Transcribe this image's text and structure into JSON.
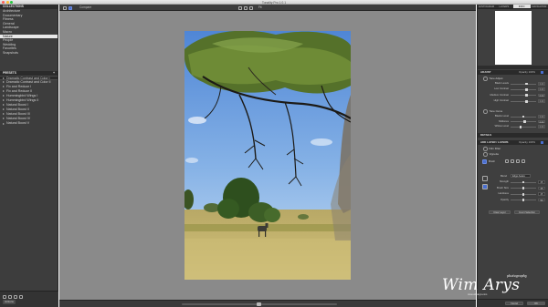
{
  "window": {
    "title": "Tonality Pro 1.0.1"
  },
  "left_panel": {
    "collections_title": "COLLECTIONS",
    "collections": [
      {
        "label": "Architecture",
        "selected": false
      },
      {
        "label": "Documentary",
        "selected": false
      },
      {
        "label": "Fitness",
        "selected": false
      },
      {
        "label": "General",
        "selected": false
      },
      {
        "label": "Landscape",
        "selected": false
      },
      {
        "label": "Macro",
        "selected": false
      },
      {
        "label": "Nature",
        "selected": true
      },
      {
        "label": "People",
        "selected": false
      },
      {
        "label": "Wedding",
        "selected": false
      },
      {
        "label": "Favorites",
        "selected": false
      },
      {
        "label": "Snapshots",
        "selected": false
      }
    ],
    "presets_title": "PRESETS",
    "presets_add": "+",
    "presets": [
      {
        "label": "Dramatic Contrast and Color I",
        "selected": true
      },
      {
        "label": "Dramatic Contrast and Color II",
        "selected": false
      },
      {
        "label": "Fix and Reduce I",
        "selected": false
      },
      {
        "label": "Fix and Reduce II",
        "selected": false
      },
      {
        "label": "Hummingbird Wings I",
        "selected": false
      },
      {
        "label": "Hummingbird Wings II",
        "selected": false
      },
      {
        "label": "Natural Boost I",
        "selected": false
      },
      {
        "label": "Natural Boost II",
        "selected": false
      },
      {
        "label": "Natural Boost III",
        "selected": false
      },
      {
        "label": "Natural Boost IV",
        "selected": false
      },
      {
        "label": "Natural Boost V",
        "selected": false
      }
    ],
    "bottom_button": "Actions"
  },
  "toolbar": {
    "left_label": "Compare",
    "zoom_label": "Fit",
    "icons": [
      "view-icon",
      "split-icon",
      "undo-icon",
      "redo-icon",
      "zoom-out-icon",
      "zoom-in-icon"
    ]
  },
  "canvas": {
    "image_alt": "Savanna landscape with acacia tree and zebra"
  },
  "right_panel": {
    "tabs": [
      {
        "label": "HISTOGRAM",
        "active": false
      },
      {
        "label": "LAYERS",
        "active": false
      },
      {
        "label": "INFO",
        "active": true
      },
      {
        "label": "NAVIGATOR",
        "active": false
      }
    ],
    "section_adjust": {
      "title": "ADJUST",
      "dropdown": "Opacity",
      "opacity": "100%",
      "group1_title": "Tone Adjust",
      "rows1": [
        {
          "label": "Black Levels",
          "value": "0.00",
          "pos": 0.62
        },
        {
          "label": "Low Contrast",
          "value": "0.00",
          "pos": 0.62
        },
        {
          "label": "Medium Contrast",
          "value": "0.00",
          "pos": 0.62
        },
        {
          "label": "High Contrast",
          "value": "0.00",
          "pos": 0.62
        }
      ],
      "group2_title": "Tone Curve",
      "rows2": [
        {
          "label": "Blacks Level",
          "value": "0.00",
          "pos": 0.5
        },
        {
          "label": "Midtones",
          "value": "0.00",
          "pos": 0.55
        },
        {
          "label": "Whites Level",
          "value": "0.00",
          "pos": 0.4
        }
      ]
    },
    "section_details": {
      "title": "DETAILS"
    },
    "section_layer": {
      "title": "ADD LAYER / LAYERS",
      "dropdown": "Opacity",
      "opacity": "100%",
      "item1": "Film Filter",
      "item2": "Vignette",
      "brush_label": "Brush",
      "blend_label": "Blend",
      "blend_value": "Edge Aware",
      "rows": [
        {
          "label": "Strength",
          "value": "25",
          "pos": 0.5
        },
        {
          "label": "Brush Size",
          "value": "25",
          "pos": 0.5
        },
        {
          "label": "Hardness",
          "value": "25",
          "pos": 0.5
        },
        {
          "label": "Opacity",
          "value": "50",
          "pos": 0.5
        }
      ],
      "btn_left": "Clear Layer",
      "btn_right": "Invert Selection"
    },
    "bottom": {
      "cancel": "Cancel",
      "done": "OK"
    }
  },
  "watermark": {
    "name": "Wim Arys",
    "tagline": "photography",
    "url": "www.wimarys.com"
  },
  "colors": {
    "accent": "#4a6fd0",
    "panel": "#3d3d3d",
    "canvas_bg": "#8a8a8a"
  }
}
